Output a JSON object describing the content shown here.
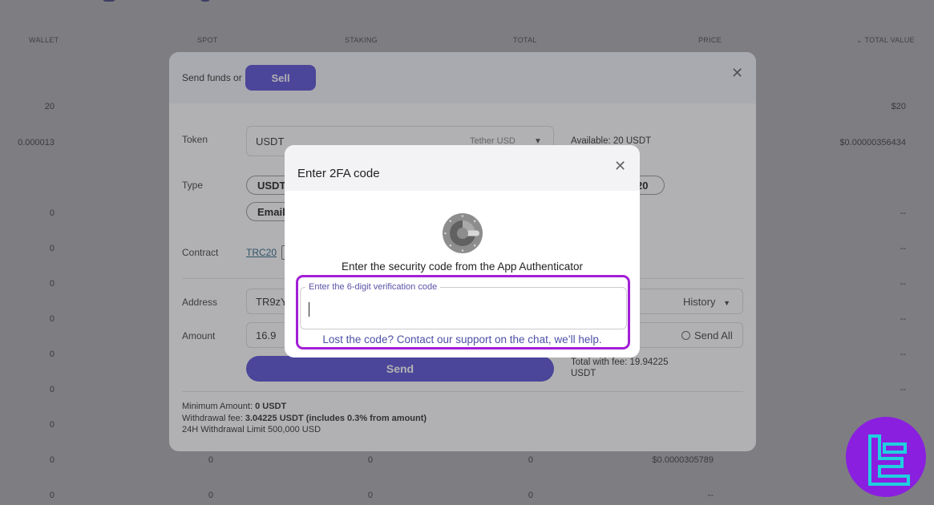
{
  "table": {
    "headers": [
      "WALLET",
      "SPOT",
      "STAKING",
      "TOTAL",
      "PRICE",
      "TOTAL VALUE"
    ],
    "rows": [
      {
        "wallet": "20",
        "value": "$20"
      },
      {
        "wallet": "0.000013",
        "value": "$0.00000356434"
      },
      {
        "wallet": "0",
        "value": "--"
      },
      {
        "wallet": "0",
        "value": "--"
      },
      {
        "wallet": "0",
        "value": "--"
      },
      {
        "wallet": "0",
        "value": "--"
      },
      {
        "wallet": "0",
        "value": "--"
      },
      {
        "wallet": "0",
        "value": "--"
      },
      {
        "wallet": "0",
        "value": "--"
      }
    ],
    "row_bottom1": {
      "wallet": "0",
      "spot": "0",
      "staking": "0",
      "total": "0",
      "price": "$0.0000305789"
    },
    "row_bottom2": {
      "wallet": "0",
      "spot": "0",
      "staking": "0",
      "total": "0",
      "price": "--"
    }
  },
  "send_modal": {
    "send_label": "Send funds or",
    "sell_label": "Sell",
    "token_label": "Token",
    "token_value": "USDT",
    "token_name": "Tether USD",
    "available": "Available: 20 USDT",
    "type_label": "Type",
    "type_option_1": "USDT",
    "type_option_2": "Email",
    "type_option_3": "20",
    "contract_label": "Contract",
    "contract_value": "TRC20",
    "address_label": "Address",
    "address_value": "TR9zY",
    "history_label": "History",
    "amount_label": "Amount",
    "amount_value": "16.9",
    "send_all_label": "Send All",
    "send_label_btn": "Send",
    "total_with_fee": "Total with fee: 19.94225",
    "total_unit": "USDT",
    "min_amount_label": "Minimum Amount:",
    "min_amount_value": "0 USDT",
    "fee_label": "Withdrawal fee:",
    "fee_value": "3.04225 USDT (includes 0.3% from amount)",
    "limit_text": "24H Withdrawal Limit 500,000 USD"
  },
  "tfa_modal": {
    "title": "Enter 2FA code",
    "instruction": "Enter the security code from the App Authenticator",
    "field_label": "Enter the 6-digit verification code",
    "help_text": "Lost the code? Contact our support on the chat, we’ll help."
  },
  "colors": {
    "accent": "#5b53d6",
    "highlight": "#a21fd6",
    "watermark": "#8a1fe0"
  }
}
